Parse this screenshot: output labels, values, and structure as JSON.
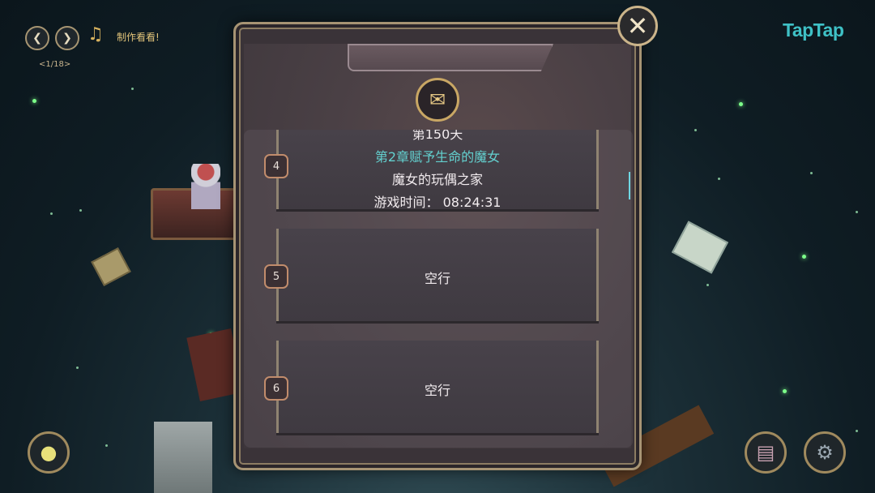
{
  "top_bar": {
    "prev_icon": "chevron-left-icon",
    "next_icon": "chevron-right-icon",
    "music_icon": "music-note-icon",
    "music_title": "制作看看!",
    "track_counter": "<1/18>"
  },
  "brand": {
    "logo_text": "TapTap",
    "color": "#3fc1c6"
  },
  "dialog": {
    "title": "",
    "emblem_icon": "save-file-icon",
    "close_icon": "close-icon",
    "slots": [
      {
        "number": "4",
        "day": "第150天",
        "chapter": "第2章赋予生命的魔女",
        "location": "魔女的玩偶之家",
        "playtime_label": "游戏时间：",
        "playtime": "08:24:31"
      },
      {
        "number": "5",
        "status": "空行"
      },
      {
        "number": "6",
        "status": "空行"
      }
    ]
  },
  "bottom_bar": {
    "left_icon": "chick-icon",
    "book_icon": "book-icon",
    "settings_icon": "gear-icon"
  },
  "colors": {
    "accent": "#63d0cf",
    "frame": "#a79474",
    "star": "#7dff8a"
  }
}
